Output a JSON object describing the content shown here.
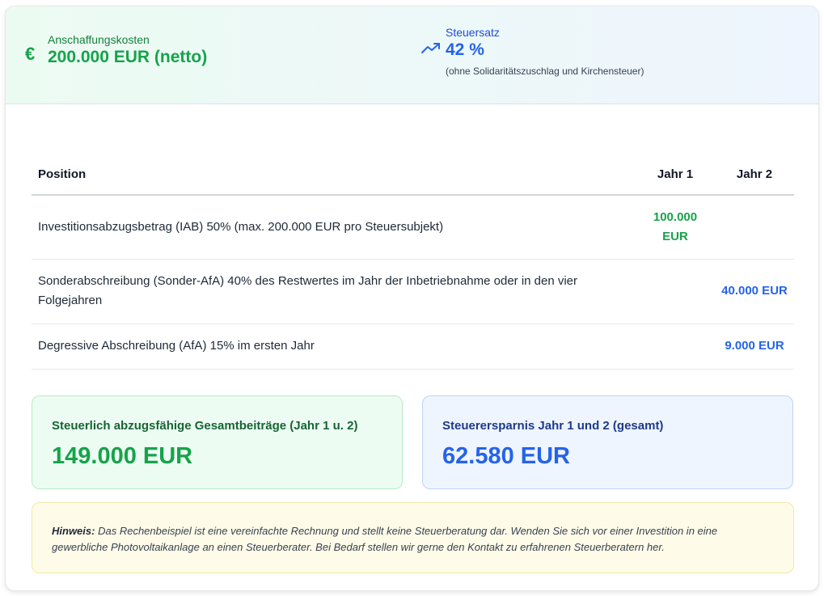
{
  "header": {
    "cost": {
      "icon": "euro-icon",
      "label": "Anschaffungskosten",
      "value": "200.000 EUR (netto)"
    },
    "tax": {
      "icon": "trending-up-icon",
      "label": "Steuersatz",
      "value": "42 %",
      "note": "(ohne Solidaritätszuschlag und Kirchensteuer)"
    }
  },
  "table": {
    "headers": [
      "Position",
      "Jahr 1",
      "Jahr 2"
    ],
    "rows": [
      {
        "position": "Investitionsabzugsbetrag (IAB) 50% (max. 200.000 EUR pro Steuersubjekt)",
        "year1": "100.000 EUR",
        "year2": ""
      },
      {
        "position": "Sonderabschreibung (Sonder-AfA) 40% des Restwertes im Jahr der Inbetriebnahme oder in den vier Folgejahren",
        "year1": "",
        "year2": "40.000 EUR"
      },
      {
        "position": "Degressive Abschreibung (AfA) 15% im ersten Jahr",
        "year1": "",
        "year2": "9.000 EUR"
      }
    ]
  },
  "summary": {
    "deductible": {
      "title": "Steuerlich abzugsfähige Gesamtbeiträge (Jahr 1 u. 2)",
      "value": "149.000 EUR"
    },
    "savings": {
      "title": "Steuerersparnis Jahr 1 und 2 (gesamt)",
      "value": "62.580 EUR"
    }
  },
  "notice": {
    "label": "Hinweis:",
    "text": "Das Rechenbeispiel ist eine vereinfachte Rechnung und stellt keine Steuerberatung dar. Wenden Sie sich vor einer Investition in eine gewerbliche Photovoltaikanlage an einen Steuerberater. Bei Bedarf stellen wir gerne den Kontakt zu erfahrenen Steuerberatern her."
  },
  "colors": {
    "green": "#16a34a",
    "blue": "#2563eb"
  }
}
